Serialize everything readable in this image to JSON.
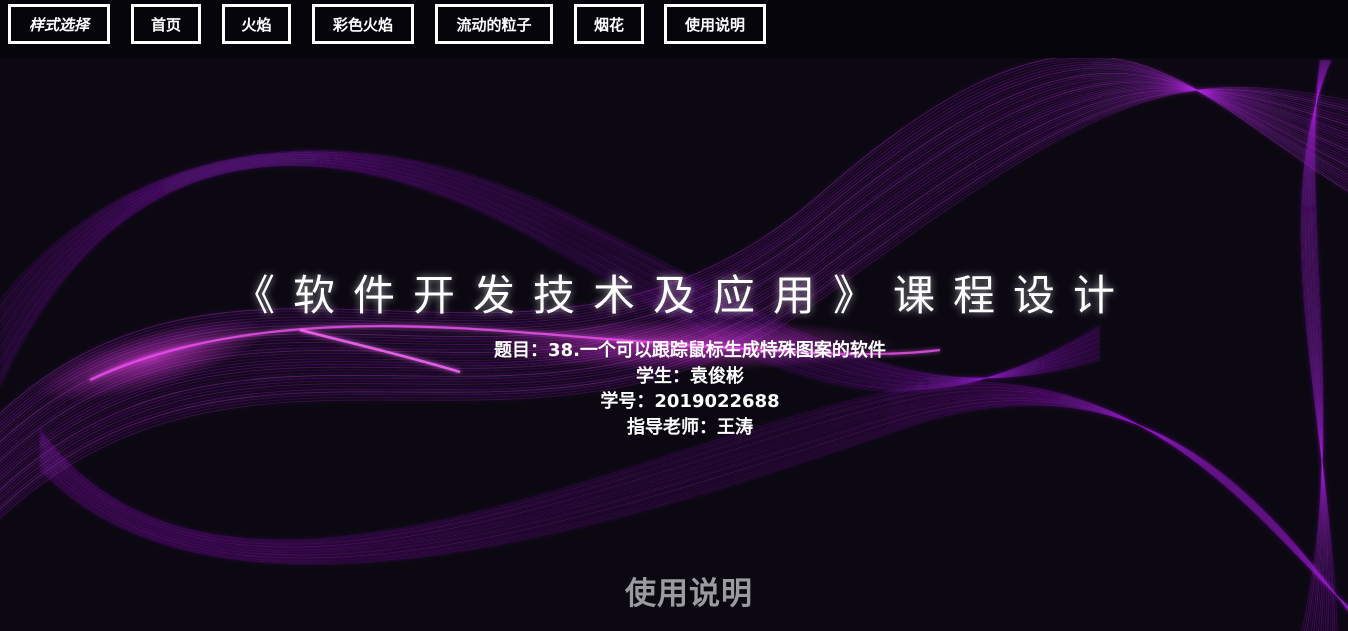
{
  "nav": {
    "style_select": "样式选择",
    "home": "首页",
    "flame": "火焰",
    "color_flame": "彩色火焰",
    "flowing_particles": "流动的粒子",
    "fireworks": "烟花",
    "instructions": "使用说明"
  },
  "hero": {
    "title": "《软件开发技术及应用》课程设计",
    "topic": "题目：38.一个可以跟踪鼠标生成特殊图案的软件",
    "student": "学生：袁俊彬",
    "student_id": "学号：2019022688",
    "advisor": "指导老师：王涛"
  },
  "footer": {
    "instructions_heading": "使用说明"
  },
  "colors": {
    "background": "#0b0812",
    "topbar": "#07050c",
    "accent": "#c21dff",
    "text": "#ffffff",
    "muted": "#9a9aa0"
  }
}
